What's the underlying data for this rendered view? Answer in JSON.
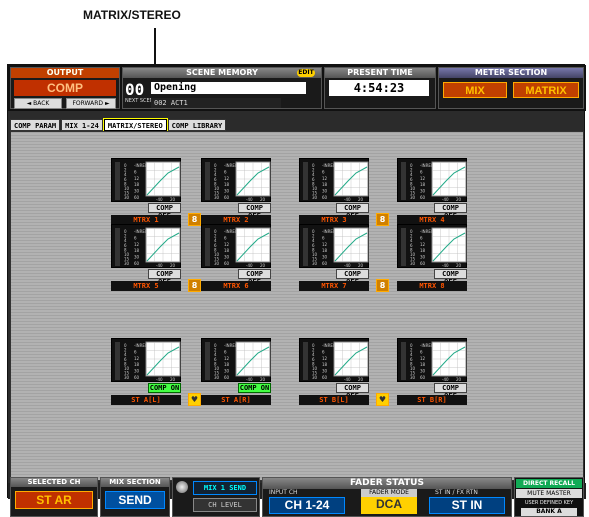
{
  "callout": {
    "label": "MATRIX/STEREO"
  },
  "header": {
    "output_title": "OUTPUT",
    "output_value": "COMP",
    "back_label": "◄ BACK",
    "forward_label": "FORWARD ►",
    "scene_title": "SCENE MEMORY",
    "edit_badge": "EDIT",
    "scene_number": "00",
    "scene_name": "Opening",
    "next_label": "NEXT SCENE",
    "next_value": "002 ACT1",
    "time_title": "PRESENT TIME",
    "time_value": "4:54:23",
    "meter_title": "METER SECTION",
    "meter_mix": "MIX",
    "meter_matrix": "MATRIX"
  },
  "tabs": [
    {
      "label": "COMP PARAM"
    },
    {
      "label": "MIX 1-24"
    },
    {
      "label": "MATRIX/STEREO"
    },
    {
      "label": "COMP LIBRARY"
    }
  ],
  "meter_scale": [
    "0",
    "2",
    "4",
    "6",
    "8",
    "10",
    "15",
    "30"
  ],
  "gr_scale": [
    "-INRED",
    "6",
    "12",
    "18",
    "30",
    "60"
  ],
  "graph_axis": [
    "-40",
    "20"
  ],
  "channels": [
    {
      "name": "MTRX 1",
      "comp": "COMP OFF",
      "on": false,
      "link": "8"
    },
    {
      "name": "MTRX 2",
      "comp": "COMP OFF",
      "on": false
    },
    {
      "name": "MTRX 3",
      "comp": "COMP OFF",
      "on": false,
      "link": "8"
    },
    {
      "name": "MTRX 4",
      "comp": "COMP OFF",
      "on": false
    },
    {
      "name": "MTRX 5",
      "comp": "COMP OFF",
      "on": false,
      "link": "8"
    },
    {
      "name": "MTRX 6",
      "comp": "COMP OFF",
      "on": false
    },
    {
      "name": "MTRX 7",
      "comp": "COMP OFF",
      "on": false,
      "link": "8"
    },
    {
      "name": "MTRX 8",
      "comp": "COMP OFF",
      "on": false
    },
    {
      "name": "ST A[L]",
      "comp": "COMP ON",
      "on": true,
      "link": "♥"
    },
    {
      "name": "ST A[R]",
      "comp": "COMP ON",
      "on": true
    },
    {
      "name": "ST B[L]",
      "comp": "COMP OFF",
      "on": false,
      "link": "♥"
    },
    {
      "name": "ST B[R]",
      "comp": "COMP OFF",
      "on": false
    }
  ],
  "footer": {
    "selected_title": "SELECTED CH",
    "selected_value": "ST AR",
    "mix_title": "MIX SECTION",
    "mix_value": "SEND",
    "mix1_send": "MIX 1 SEND",
    "ch_level": "CH LEVEL",
    "fader_title": "FADER STATUS",
    "input_ch_label": "INPUT CH",
    "input_ch_value": "CH 1-24",
    "fader_mode_label": "FADER MODE",
    "fader_mode_value": "DCA",
    "st_in_label": "ST IN / FX RTN",
    "st_in_value": "ST IN",
    "direct_recall": "DIRECT RECALL",
    "mute_master": "MUTE MASTER",
    "user_defined": "USER DEFINED KEY",
    "bank": "BANK A"
  }
}
